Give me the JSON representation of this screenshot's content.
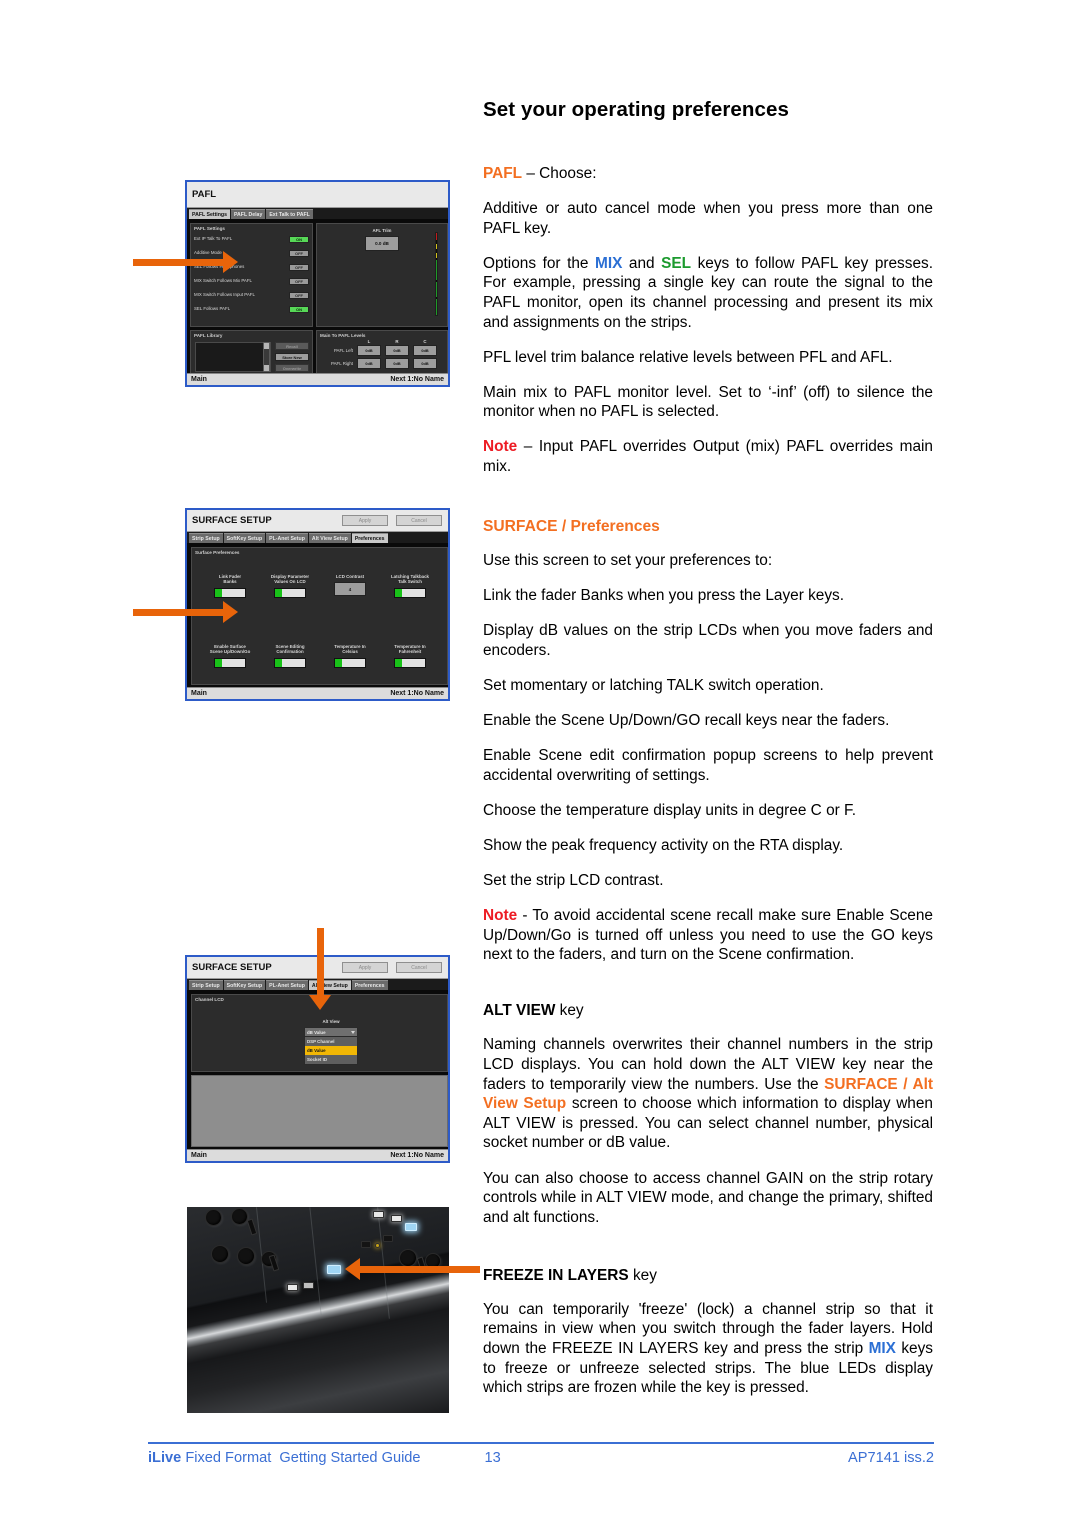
{
  "page": {
    "title": "Set your operating preferences"
  },
  "sections": {
    "pafl": {
      "lead_keyword": "PAFL",
      "lead_rest": " – Choose:",
      "p1": "Additive or auto cancel mode when you press more than one PAFL key.",
      "p2_a": "Options for the ",
      "p2_mix": "MIX",
      "p2_b": " and ",
      "p2_sel": "SEL",
      "p2_c": " keys to follow PAFL key presses.  For example, pressing a single key can route the signal to the PAFL monitor, open its channel processing and present its mix and assignments on the strips.",
      "p3": "PFL level trim balance relative levels between PFL and AFL.",
      "p4": "Main mix to PAFL monitor level.  Set to ‘-inf’ (off) to silence the monitor when no PAFL is selected.",
      "note_label": "Note",
      "note_text": " – Input PAFL overrides Output (mix) PAFL overrides main mix."
    },
    "surface_prefs": {
      "heading_a": "SURFACE",
      "heading_b": " / Preferences",
      "p1": "Use this screen to set your preferences to:",
      "p2": "Link the fader Banks when you press the Layer keys.",
      "p3": "Display dB values on the strip LCDs when you move faders and encoders.",
      "p4": "Set momentary or latching TALK switch operation.",
      "p5": "Enable the Scene Up/Down/GO recall keys near the faders.",
      "p6": "Enable Scene edit confirmation popup screens to help prevent accidental overwriting of settings.",
      "p7": "Choose the temperature display units in degree C or F.",
      "p8": "Show the peak frequency activity on the RTA display.",
      "p9": "Set the strip LCD contrast.",
      "note_label": "Note",
      "note_text": " - To avoid accidental scene recall make sure Enable Scene Up/Down/Go is turned off unless you need to use the GO keys next to the faders, and turn on the Scene confirmation."
    },
    "alt_view": {
      "head_bold": "ALT VIEW",
      "head_rest": " key",
      "p1_a": "Naming channels overwrites their channel numbers in the strip LCD displays. You can hold down the ALT VIEW key near the faders to temporarily view the numbers. Use the ",
      "p1_link": "SURFACE  /  Alt  View  Setup",
      "p1_b": " screen to choose which information to display when ALT VIEW is pressed. You can select channel number, physical socket number or dB value.",
      "p2": "You can also choose to access channel GAIN on the strip rotary controls while in ALT VIEW mode, and change the primary, shifted and alt functions."
    },
    "freeze": {
      "head_bold": "FREEZE IN LAYERS",
      "head_rest": " key",
      "p1_a": "You can temporarily 'freeze' (lock) a channel strip so that it remains in view when you switch through the fader layers. Hold down the FREEZE IN LAYERS key and press the strip ",
      "p1_mix": "MIX",
      "p1_b": " keys to freeze or unfreeze selected strips. The blue LEDs display which strips are frozen while the key is pressed."
    }
  },
  "shot_pafl": {
    "title": "PAFL",
    "tabs": [
      "PAFL Settings",
      "PAFL Delay",
      "Ext Talk to PAFL"
    ],
    "active_tab": "PAFL Settings",
    "settings_header": "PAFL Settings",
    "settings": [
      {
        "label": "Ext IP Talk To PAFL",
        "value": "ON"
      },
      {
        "label": "Additive Mode",
        "value": "OFF"
      },
      {
        "label": "SEL Follows Headphones",
        "value": "OFF"
      },
      {
        "label": "MIX Switch Follows Mix PAFL",
        "value": "OFF"
      },
      {
        "label": "MIX Switch Follows Input PAFL",
        "value": "OFF"
      },
      {
        "label": "SEL Follows PAFL",
        "value": "ON"
      }
    ],
    "afl_trim_label": "AFL Trim",
    "afl_trim_value": "0.0 dB",
    "library_header": "PAFL Library",
    "library_buttons": [
      "Recall",
      "Store New",
      "Overwrite"
    ],
    "levels_header": "Main To PAFL Levels",
    "levels_cols": [
      "L",
      "R",
      "C"
    ],
    "levels_rows": [
      {
        "label": "PAFL Left",
        "values": [
          "0dB",
          "0dB",
          "0dB"
        ]
      },
      {
        "label": "PAFL Right",
        "values": [
          "0dB",
          "0dB",
          "0dB"
        ]
      }
    ],
    "status_left": "Main",
    "status_right": "Next 1:No Name"
  },
  "shot_surface_prefs": {
    "title": "SURFACE SETUP",
    "header_buttons": [
      "Apply",
      "Cancel"
    ],
    "tabs": [
      "Strip Setup",
      "SoftKey Setup",
      "PL-Anet Setup",
      "Alt View Setup",
      "Preferences"
    ],
    "active_tab": "Preferences",
    "panel_header": "Surface Preferences",
    "row1": [
      {
        "label": "Link Fader\nBanks",
        "type": "switch"
      },
      {
        "label": "Display Parameter\nValues On LCD",
        "type": "switch"
      },
      {
        "label": "LCD Contrast",
        "type": "value",
        "value": "4"
      },
      {
        "label": "Latching Talkback\nTalk Switch",
        "type": "switch"
      }
    ],
    "row2": [
      {
        "label": "Enable Surface\nScene Up/Down/Go",
        "type": "switch"
      },
      {
        "label": "Scene Editing\nConfirmation",
        "type": "switch"
      },
      {
        "label": "Temperature In\nCelsius",
        "type": "switch"
      },
      {
        "label": "Temperature In\nFahrenheit",
        "type": "switch"
      }
    ],
    "status_left": "Main",
    "status_right": "Next 1:No Name"
  },
  "shot_alt_view": {
    "title": "SURFACE SETUP",
    "header_buttons": [
      "Apply",
      "Cancel"
    ],
    "tabs": [
      "Strip Setup",
      "SoftKey Setup",
      "PL-Anet Setup",
      "Alt View Setup",
      "Preferences"
    ],
    "active_tab": "Alt View Setup",
    "panel_header": "Channel LCD",
    "field_label": "Alt View",
    "selected_value": "dB Value",
    "options": [
      "DSP Channel",
      "dB Value",
      "Socket ID"
    ],
    "status_left": "Main",
    "status_right": "Next 1:No Name"
  },
  "footer": {
    "brand": "iLive",
    "product": " Fixed Format  Getting Started Guide",
    "page_number": "13",
    "doc_ref": "AP7141 iss.2"
  },
  "colors": {
    "accent_orange": "#F36F21",
    "arrow_orange": "#E8640A",
    "note_red": "#ED1C24",
    "mix_blue": "#2B6FD4",
    "sel_green": "#1C9A2E",
    "footer_blue": "#3B6FD4"
  }
}
